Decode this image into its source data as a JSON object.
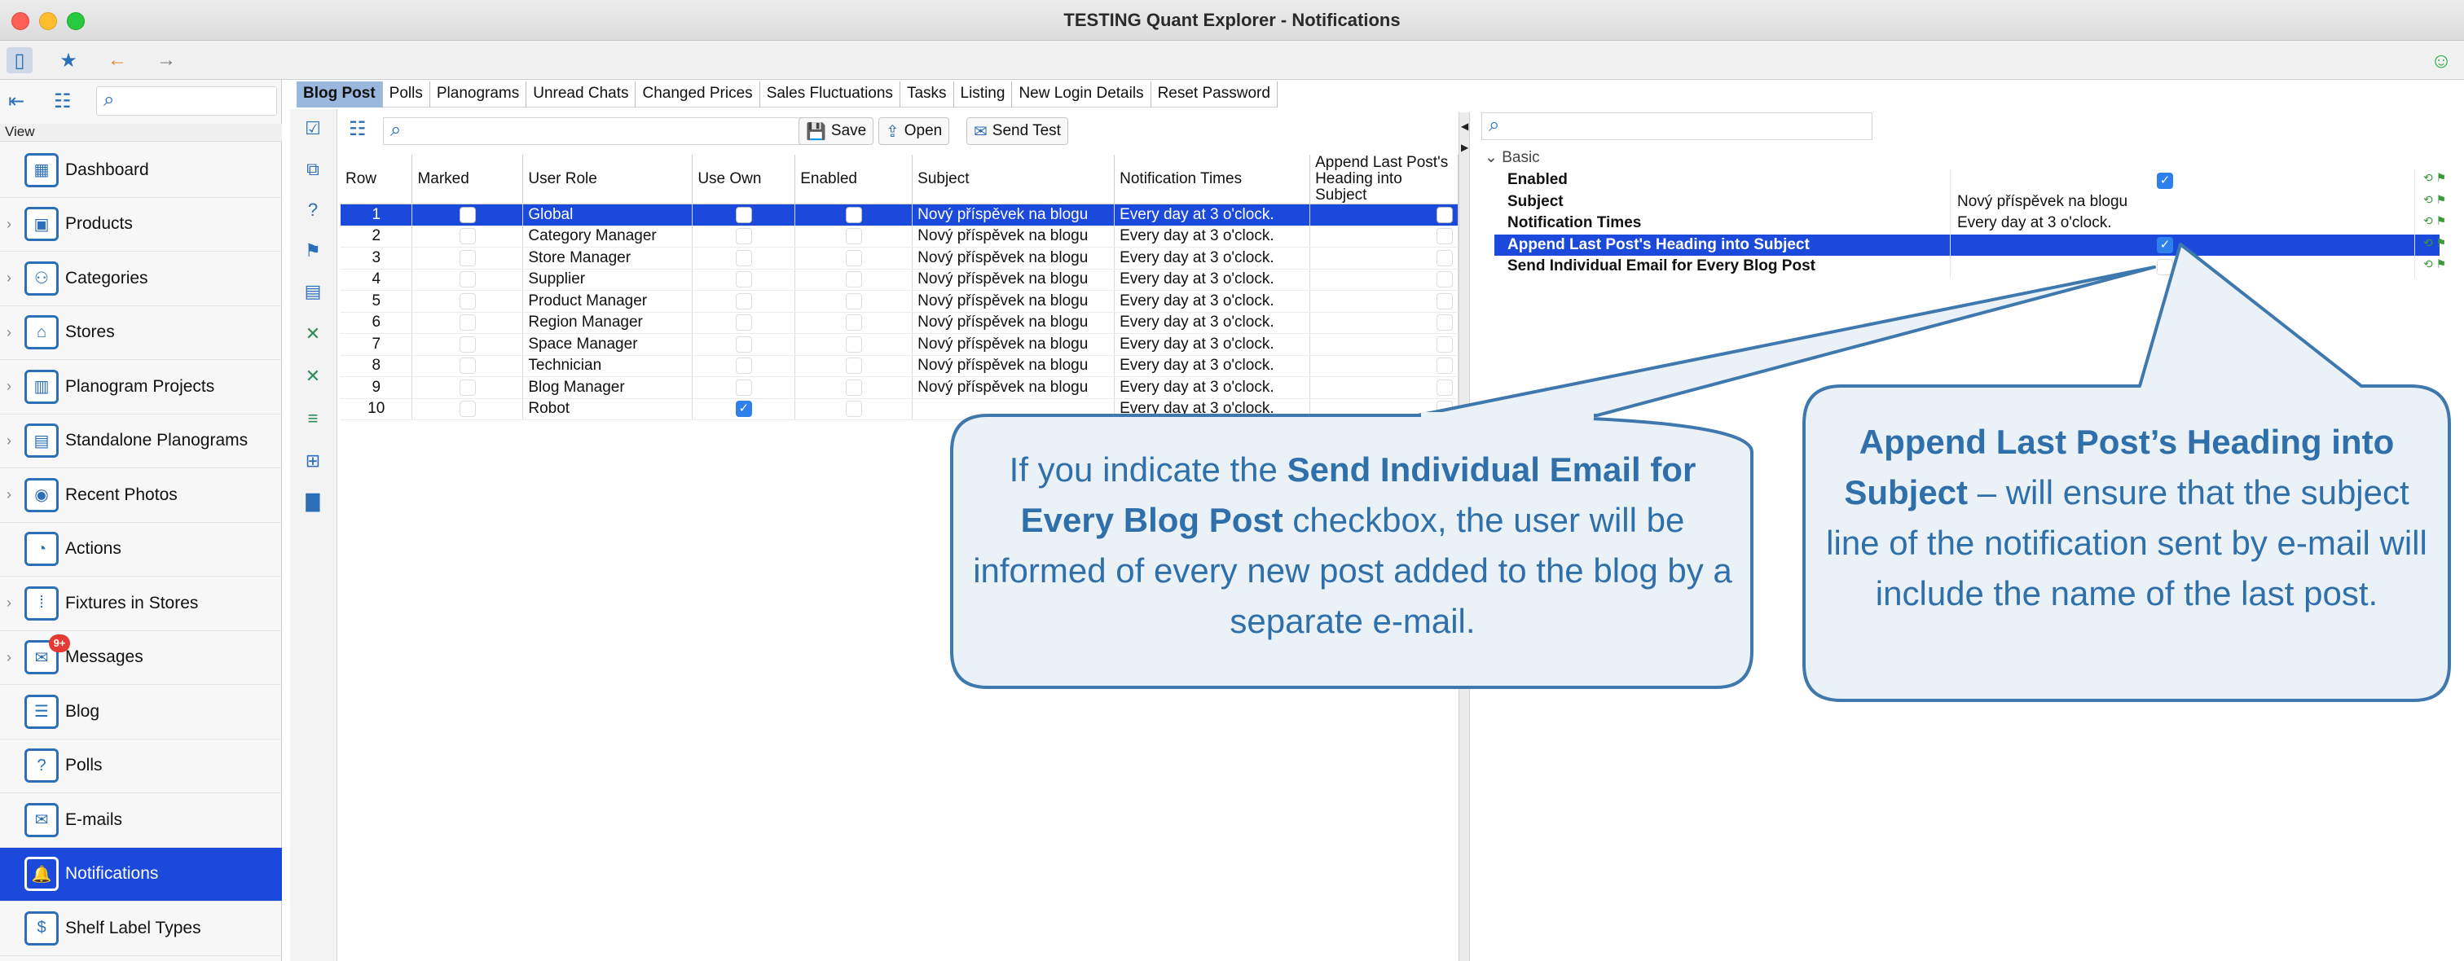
{
  "window": {
    "title": "TESTING Quant Explorer - Notifications"
  },
  "sidebar": {
    "header": "View",
    "items": [
      {
        "label": "Dashboard",
        "icon": "dashboard-icon",
        "glyph": "▦",
        "chevron": false
      },
      {
        "label": "Products",
        "icon": "products-icon",
        "glyph": "▣",
        "chevron": true
      },
      {
        "label": "Categories",
        "icon": "categories-icon",
        "glyph": "⚇",
        "chevron": true
      },
      {
        "label": "Stores",
        "icon": "stores-icon",
        "glyph": "⌂",
        "chevron": true
      },
      {
        "label": "Planogram Projects",
        "icon": "planogram-projects-icon",
        "glyph": "▥",
        "chevron": true
      },
      {
        "label": "Standalone Planograms",
        "icon": "standalone-planograms-icon",
        "glyph": "▤",
        "chevron": true
      },
      {
        "label": "Recent Photos",
        "icon": "camera-icon",
        "glyph": "◉",
        "chevron": true
      },
      {
        "label": "Actions",
        "icon": "actions-icon",
        "glyph": "◔",
        "chevron": false
      },
      {
        "label": "Fixtures in Stores",
        "icon": "fixtures-icon",
        "glyph": "⁞",
        "chevron": true
      },
      {
        "label": "Messages",
        "icon": "messages-icon",
        "glyph": "✉",
        "chevron": true,
        "badge": "9+"
      },
      {
        "label": "Blog",
        "icon": "blog-icon",
        "glyph": "☰",
        "chevron": false
      },
      {
        "label": "Polls",
        "icon": "polls-icon",
        "glyph": "?",
        "chevron": false
      },
      {
        "label": "E-mails",
        "icon": "email-icon",
        "glyph": "✉",
        "chevron": false
      },
      {
        "label": "Notifications",
        "icon": "notifications-icon",
        "glyph": "🔔",
        "chevron": false,
        "active": true
      },
      {
        "label": "Shelf Label Types",
        "icon": "shelf-label-icon",
        "glyph": "$",
        "chevron": false
      }
    ]
  },
  "tabs": [
    "Blog Post",
    "Polls",
    "Planograms",
    "Unread Chats",
    "Changed Prices",
    "Sales Fluctuations",
    "Tasks",
    "Listing",
    "New Login Details",
    "Reset Password"
  ],
  "toolbar_buttons": {
    "save": "Save",
    "open": "Open",
    "send_test": "Send Test"
  },
  "grid": {
    "columns": [
      "Row",
      "Marked",
      "User Role",
      "Use Own",
      "Enabled",
      "Subject",
      "Notification Times",
      "Append Last Post's Heading into Subject"
    ],
    "rows": [
      {
        "row": "1",
        "role": "Global",
        "use_own": false,
        "enabled": false,
        "subject": "Nový příspěvek na blogu",
        "times": "Every day at 3 o'clock.",
        "append": false,
        "selected": true
      },
      {
        "row": "2",
        "role": "Category Manager",
        "use_own": false,
        "enabled": false,
        "subject": "Nový příspěvek na blogu",
        "times": "Every day at 3 o'clock.",
        "append": false
      },
      {
        "row": "3",
        "role": "Store Manager",
        "use_own": false,
        "enabled": false,
        "subject": "Nový příspěvek na blogu",
        "times": "Every day at 3 o'clock.",
        "append": false
      },
      {
        "row": "4",
        "role": "Supplier",
        "use_own": false,
        "enabled": false,
        "subject": "Nový příspěvek na blogu",
        "times": "Every day at 3 o'clock.",
        "append": false
      },
      {
        "row": "5",
        "role": "Product Manager",
        "use_own": false,
        "enabled": false,
        "subject": "Nový příspěvek na blogu",
        "times": "Every day at 3 o'clock.",
        "append": false
      },
      {
        "row": "6",
        "role": "Region Manager",
        "use_own": false,
        "enabled": false,
        "subject": "Nový příspěvek na blogu",
        "times": "Every day at 3 o'clock.",
        "append": false
      },
      {
        "row": "7",
        "role": "Space Manager",
        "use_own": false,
        "enabled": false,
        "subject": "Nový příspěvek na blogu",
        "times": "Every day at 3 o'clock.",
        "append": false
      },
      {
        "row": "8",
        "role": "Technician",
        "use_own": false,
        "enabled": false,
        "subject": "Nový příspěvek na blogu",
        "times": "Every day at 3 o'clock.",
        "append": false
      },
      {
        "row": "9",
        "role": "Blog Manager",
        "use_own": false,
        "enabled": false,
        "subject": "Nový příspěvek na blogu",
        "times": "Every day at 3 o'clock.",
        "append": false
      },
      {
        "row": "10",
        "role": "Robot",
        "use_own": true,
        "enabled": false,
        "subject": "",
        "times": "Every day at 3 o'clock.",
        "append": false
      }
    ]
  },
  "properties": {
    "section": "Basic",
    "rows": [
      {
        "key": "Enabled",
        "value": "",
        "checkbox": true,
        "checked": true
      },
      {
        "key": "Subject",
        "value": "Nový příspěvek na blogu",
        "checkbox": false
      },
      {
        "key": "Notification Times",
        "value": "Every day at 3 o'clock.",
        "checkbox": false
      },
      {
        "key": "Append Last Post's Heading into Subject",
        "value": "",
        "checkbox": true,
        "checked": true,
        "selected": true
      },
      {
        "key": "Send Individual Email for Every Blog Post",
        "value": "",
        "checkbox": true,
        "checked": false
      }
    ]
  },
  "callouts": {
    "left": {
      "p1": "If you indicate the ",
      "b1": "Send Individual Email for Every Blog Post",
      "p2": " checkbox, the user will be informed of every new post added to the blog by a separate e-mail."
    },
    "right": {
      "b1": "Append Last Post’s Heading into Subject",
      "p1": " – will ensure that the subject line of the notification sent by e-mail will include the name of the last post."
    }
  },
  "colors": {
    "selection": "#1a49dc",
    "accent": "#2c6fb7",
    "callout_fill": "#eaf1f7",
    "callout_stroke": "#3f78ad",
    "tab_active": "#9ab8de"
  }
}
